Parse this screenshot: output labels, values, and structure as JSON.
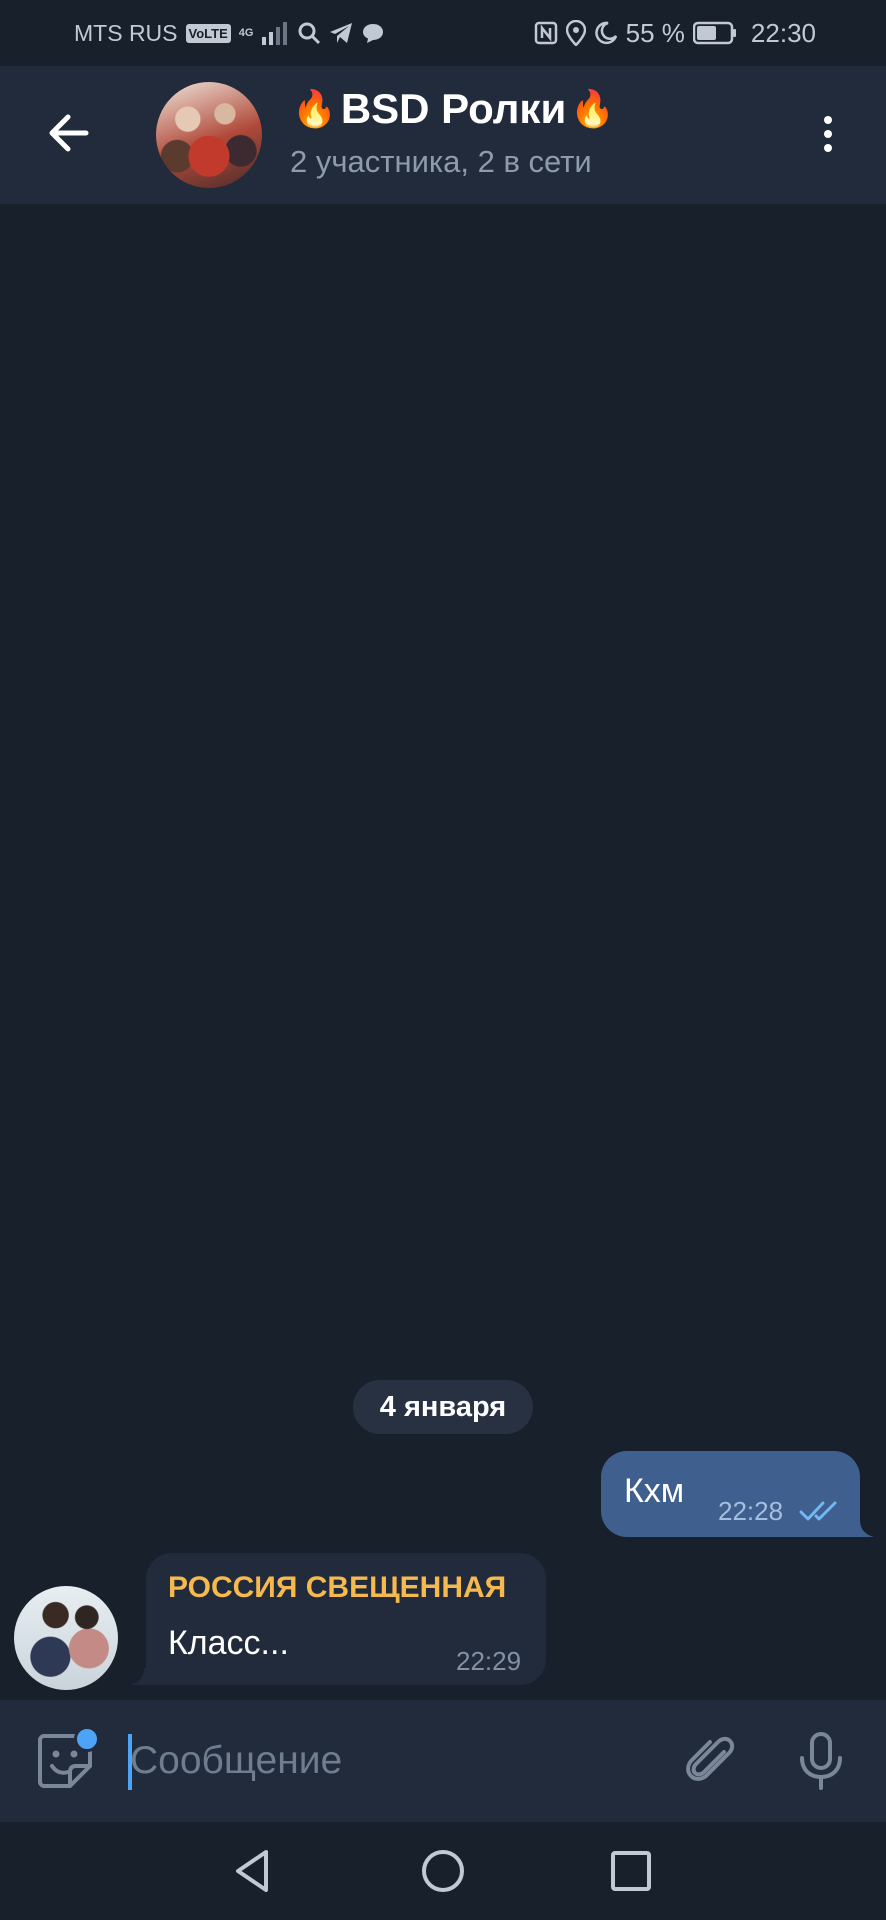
{
  "status_bar": {
    "carrier": "MTS RUS",
    "volte": "VoLTE",
    "network": "4G",
    "battery": "55 %",
    "time": "22:30"
  },
  "header": {
    "title": "BSD Ролки",
    "title_emoji": "🔥",
    "subtitle": "2 участника, 2 в сети"
  },
  "date_separator": "4 января",
  "messages": [
    {
      "direction": "outgoing",
      "text": "Кхм",
      "time": "22:28",
      "status": "read"
    },
    {
      "direction": "incoming",
      "sender": "РОССИЯ СВЕЩЕННАЯ",
      "text": "Класс...",
      "time": "22:29"
    }
  ],
  "composer": {
    "placeholder": "Сообщение",
    "value": ""
  },
  "colors": {
    "background": "#18202c",
    "header": "#222b3b",
    "outgoing_bubble": "#3f5f8e",
    "incoming_bubble": "#222b3b",
    "sender_name": "#f5b94e",
    "accent": "#4da3f5"
  },
  "icons": {
    "back": "arrow-left-icon",
    "menu": "more-vertical-icon",
    "sticker": "sticker-icon",
    "attach": "paperclip-icon",
    "mic": "microphone-icon"
  }
}
